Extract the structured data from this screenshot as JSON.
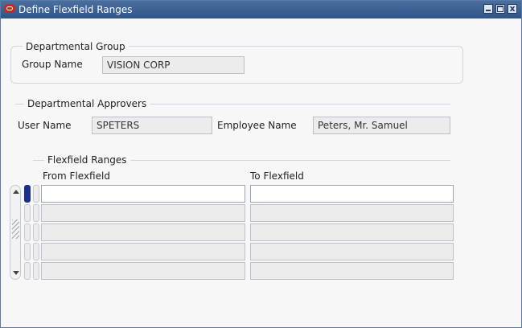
{
  "window": {
    "title": "Define Flexfield Ranges",
    "icon": "oracle-icon",
    "controls": [
      "minimize-icon",
      "maximize-icon",
      "close-icon"
    ],
    "close_glyph": "x"
  },
  "departmental_group": {
    "legend": "Departmental Group",
    "group_name_label": "Group Name",
    "group_name_value": "VISION CORP"
  },
  "departmental_approvers": {
    "legend": "Departmental Approvers",
    "user_name_label": "User Name",
    "user_name_value": "SPETERS",
    "employee_name_label": "Employee Name",
    "employee_name_value": "Peters, Mr. Samuel"
  },
  "flexfield_ranges": {
    "legend": "Flexfield Ranges",
    "columns": [
      "From Flexfield",
      "To Flexfield"
    ],
    "rows": [
      {
        "from": "",
        "to": ""
      },
      {
        "from": "",
        "to": ""
      },
      {
        "from": "",
        "to": ""
      },
      {
        "from": "",
        "to": ""
      },
      {
        "from": "",
        "to": ""
      }
    ],
    "current_row": 1
  },
  "colors": {
    "titlebar": "#3a6193",
    "current_row_indicator": "#1b2f8f"
  }
}
